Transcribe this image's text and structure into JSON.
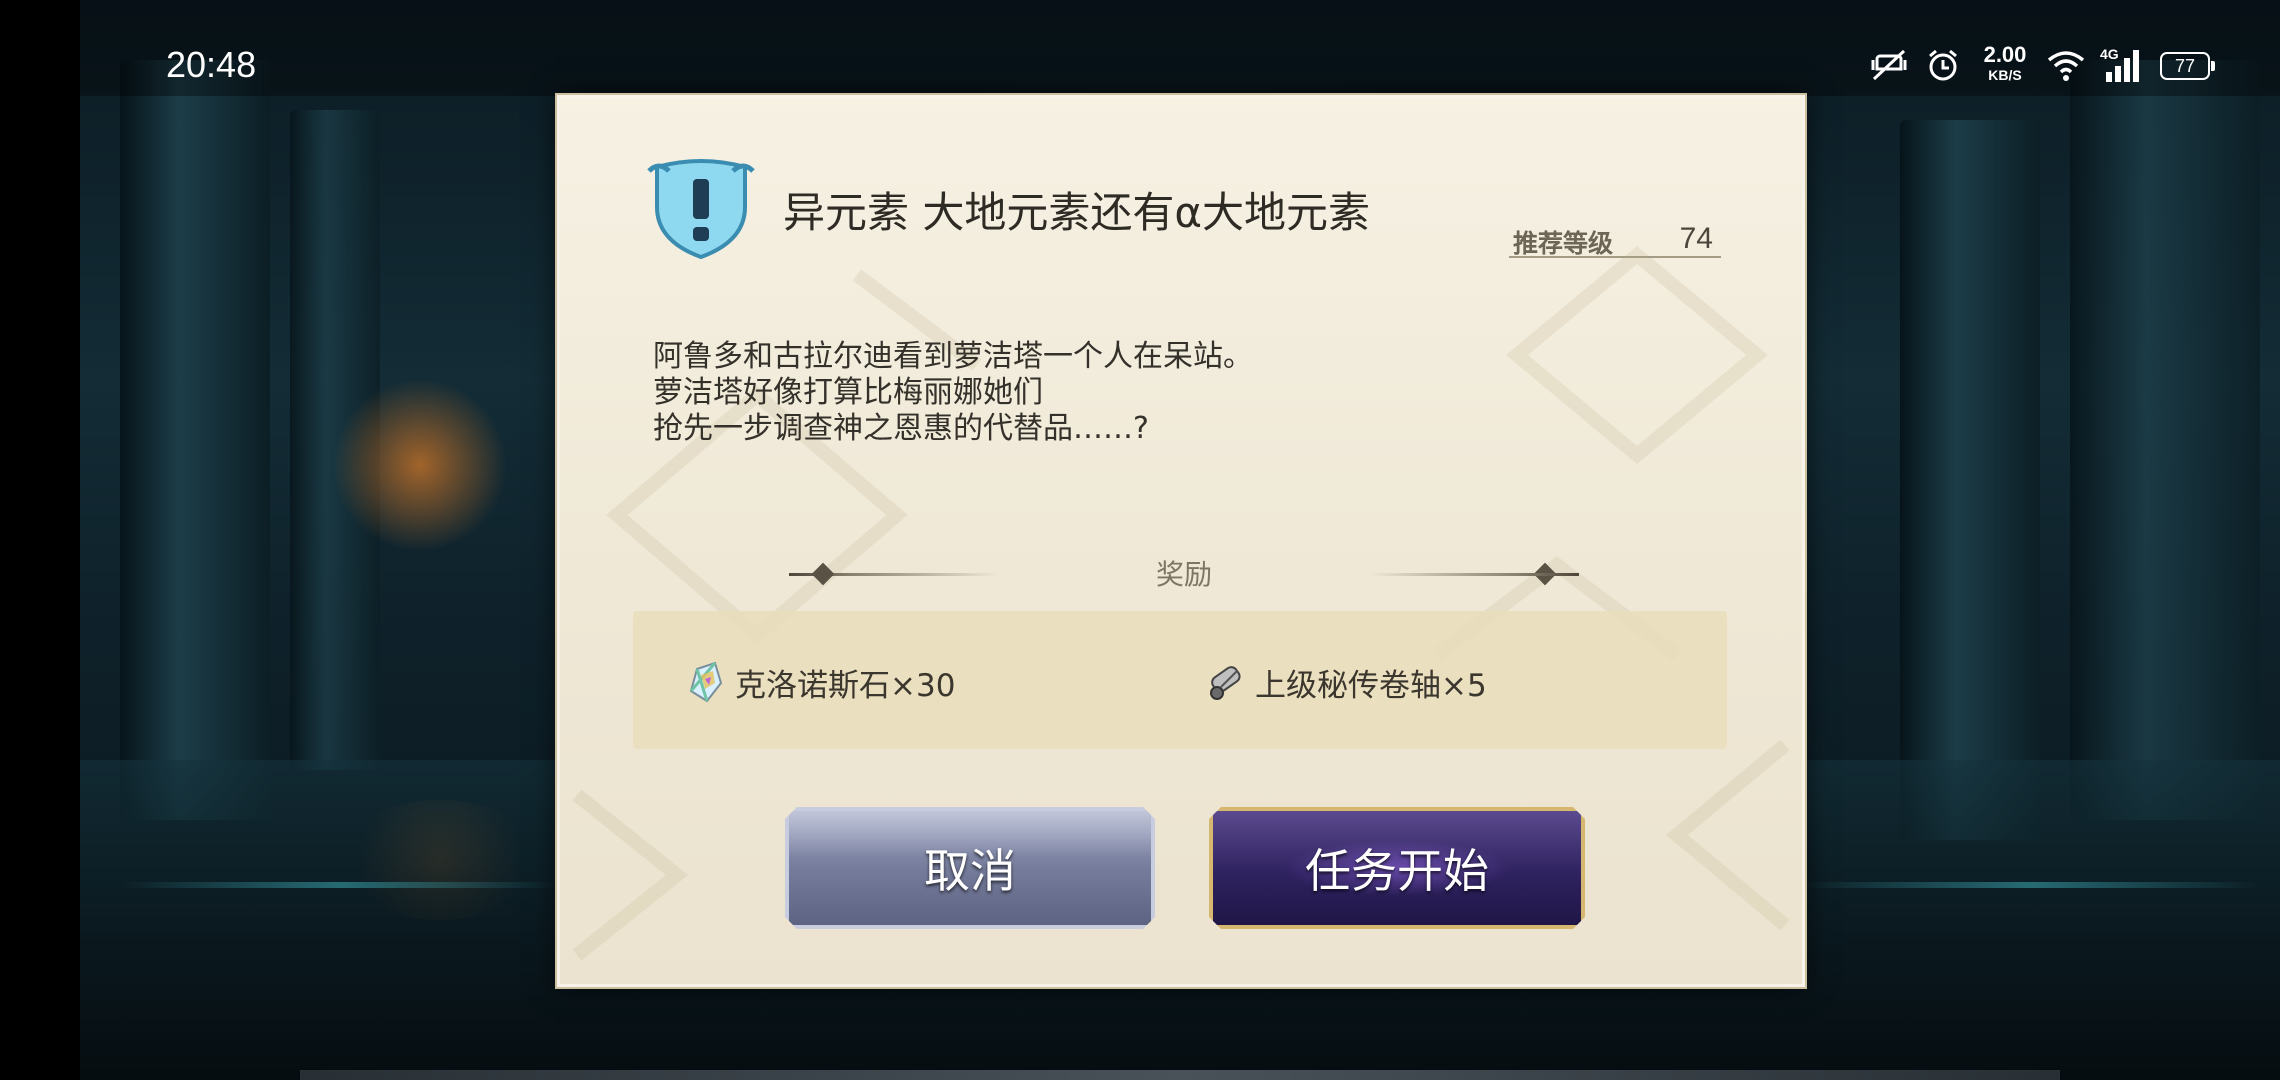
{
  "status_bar": {
    "time": "20:48",
    "net_speed_value": "2.00",
    "net_speed_unit": "KB/S",
    "network_type": "4G",
    "battery_level": "77"
  },
  "dialog": {
    "title": "异元素 大地元素还有α大地元素",
    "recommended_level_label": "推荐等级",
    "recommended_level_value": "74",
    "description_lines": [
      "阿鲁多和古拉尔迪看到萝洁塔一个人在呆站。",
      "萝洁塔好像打算比梅丽娜她们",
      "抢先一步调查神之恩惠的代替品……?"
    ],
    "reward_label": "奖励",
    "rewards": [
      {
        "name": "克洛诺斯石×30",
        "icon": "chronos-stone-icon"
      },
      {
        "name": "上级秘传卷轴×5",
        "icon": "scroll-icon"
      }
    ],
    "cancel_label": "取消",
    "start_label": "任务开始"
  }
}
